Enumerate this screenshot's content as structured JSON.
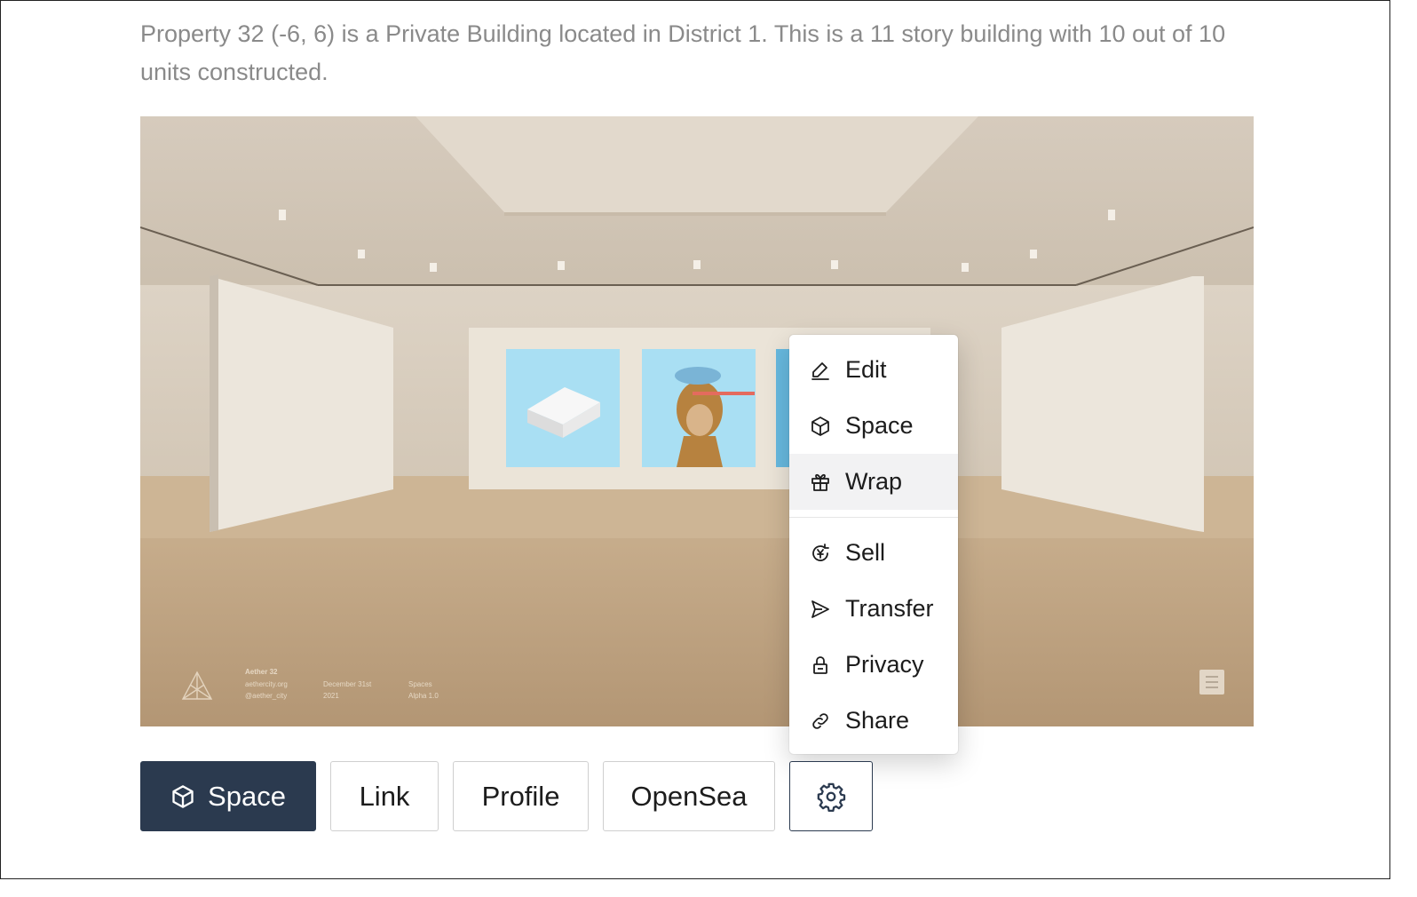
{
  "description": "Property 32 (-6, 6) is a Private Building located in District 1. This is a 11 story building with 10 out of 10 units constructed.",
  "scene": {
    "watermark": {
      "name": "Aether 32",
      "site": "aethercity.org",
      "handle": "@aether_city",
      "date_line1": "December 31st",
      "date_line2": "2021",
      "product": "Spaces",
      "version": "Alpha 1.0"
    }
  },
  "menu": {
    "items": [
      {
        "label": "Edit",
        "icon": "pencil-icon"
      },
      {
        "label": "Space",
        "icon": "cube-icon"
      },
      {
        "label": "Wrap",
        "icon": "gift-icon"
      },
      {
        "label": "Sell",
        "icon": "yen-exchange-icon"
      },
      {
        "label": "Transfer",
        "icon": "send-icon"
      },
      {
        "label": "Privacy",
        "icon": "lock-icon"
      },
      {
        "label": "Share",
        "icon": "link-icon"
      }
    ],
    "highlighted": "Wrap"
  },
  "buttons": {
    "space": "Space",
    "link": "Link",
    "profile": "Profile",
    "opensea": "OpenSea",
    "settings_icon": "gear-icon"
  },
  "colors": {
    "primary": "#2b3a4f",
    "description_text": "#8a8a8a",
    "menu_highlight": "#f2f2f3"
  }
}
